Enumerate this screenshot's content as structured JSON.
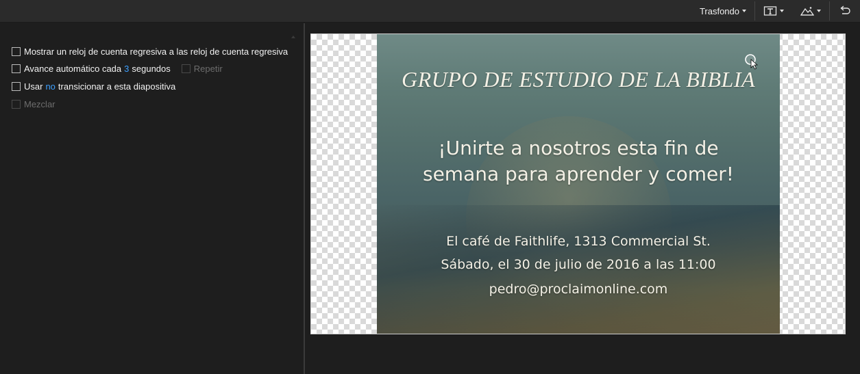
{
  "toolbar": {
    "background_label": "Trasfondo",
    "text_tool_icon": "text-box-icon",
    "image_tool_icon": "landscape-image-icon",
    "undo_icon": "undo-icon"
  },
  "options": {
    "countdown": {
      "label": "Mostrar un reloj de cuenta regresiva a las reloj de cuenta regresiva",
      "checked": false
    },
    "auto_advance": {
      "label_before": "Avance automático cada",
      "value": "3",
      "label_after": "segundos",
      "checked": false,
      "repeat_label": "Repetir",
      "repeat_enabled": false
    },
    "transition": {
      "label_before": "Usar",
      "value": "no",
      "label_after": "transicionar a esta diapositiva",
      "checked": false
    },
    "shuffle": {
      "label": "Mezclar",
      "enabled": false
    }
  },
  "slide": {
    "title": "GRUPO DE ESTUDIO DE LA BIBLIA",
    "headline_1": "¡Unirte a nosotros esta fin de",
    "headline_2": "semana para aprender y comer!",
    "location": "El café de Faithlife, 1313 Commercial St.",
    "datetime": "Sábado, el 30 de julio de 2016 a las 11:00",
    "email": "pedro@proclaimonline.com"
  },
  "colors": {
    "accent_link": "#3da0ff",
    "panel_bg": "#1e1e1e",
    "toolbar_bg": "#2b2b2b",
    "disabled_text": "#6d6d6d"
  }
}
